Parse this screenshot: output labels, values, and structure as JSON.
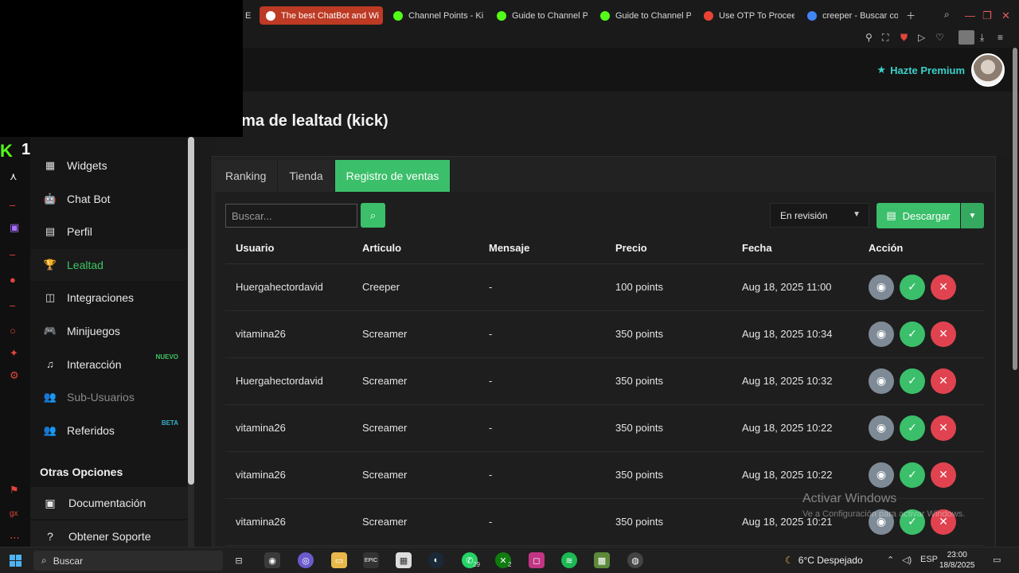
{
  "browser": {
    "tabs": [
      {
        "label": "E",
        "color": "#777777"
      },
      {
        "label": "The best ChatBot and Wi",
        "color": "#ffffff",
        "active": true
      },
      {
        "label": "Channel Points - Ki",
        "color": "#53fc18"
      },
      {
        "label": "Guide to Channel P",
        "color": "#53fc18"
      },
      {
        "label": "Guide to Channel P",
        "color": "#53fc18"
      },
      {
        "label": "Use OTP To Procee",
        "color": "#ea4335"
      },
      {
        "label": "creeper - Buscar co",
        "color": "#4285f4"
      }
    ]
  },
  "header": {
    "premium_label": "Hazte Premium",
    "page_title": "ema de lealtad (kick)"
  },
  "brand": {
    "logo": "K",
    "count": "1"
  },
  "sidebar": {
    "items": [
      {
        "label": "Widgets",
        "icon": "widgets-icon",
        "glyph": "▦"
      },
      {
        "label": "Chat Bot",
        "icon": "robot-icon",
        "glyph": "🤖"
      },
      {
        "label": "Perfil",
        "icon": "profile-card-icon",
        "glyph": "▤"
      },
      {
        "label": "Lealtad",
        "icon": "trophy-icon",
        "glyph": "🏆",
        "active": true
      },
      {
        "label": "Integraciones",
        "icon": "integrations-icon",
        "glyph": "◫"
      },
      {
        "label": "Minijuegos",
        "icon": "gamepad-icon",
        "glyph": "🎮"
      },
      {
        "label": "Interacción",
        "icon": "music-icon",
        "glyph": "♫",
        "badge": "NUEVO"
      },
      {
        "label": "Sub-Usuarios",
        "icon": "users-icon",
        "glyph": "👥",
        "dim": true
      },
      {
        "label": "Referidos",
        "icon": "users-icon",
        "glyph": "👥",
        "badge": "BETA"
      }
    ],
    "section_title": "Otras Opciones",
    "sub_items": [
      {
        "label": "Documentación",
        "icon": "book-icon",
        "glyph": "▣"
      },
      {
        "label": "Obtener Soporte",
        "icon": "question-icon",
        "glyph": "?"
      }
    ]
  },
  "tabs": [
    "Ranking",
    "Tienda",
    "Registro de ventas"
  ],
  "toolbar": {
    "search_placeholder": "Buscar...",
    "status_filter": "En revisión",
    "download_label": "Descargar"
  },
  "table": {
    "columns": [
      "Usuario",
      "Articulo",
      "Mensaje",
      "Precio",
      "Fecha",
      "Acción"
    ],
    "rows": [
      [
        "Huergahectordavid",
        "Creeper",
        "-",
        "100 points",
        "Aug 18, 2025 11:00"
      ],
      [
        "vitamina26",
        "Screamer",
        "-",
        "350 points",
        "Aug 18, 2025 10:34"
      ],
      [
        "Huergahectordavid",
        "Screamer",
        "-",
        "350 points",
        "Aug 18, 2025 10:32"
      ],
      [
        "vitamina26",
        "Screamer",
        "-",
        "350 points",
        "Aug 18, 2025 10:22"
      ],
      [
        "vitamina26",
        "Screamer",
        "-",
        "350 points",
        "Aug 18, 2025 10:22"
      ],
      [
        "vitamina26",
        "Screamer",
        "-",
        "350 points",
        "Aug 18, 2025 10:21"
      ]
    ]
  },
  "watermark": {
    "title": "Activar Windows",
    "subtitle": "Ve a Configuración para activar Windows."
  },
  "taskbar": {
    "search_label": "Buscar",
    "weather": "6°C Despejado",
    "lang": "ESP",
    "time": "23:00",
    "date": "18/8/2025",
    "badges": [
      "29",
      "2"
    ]
  },
  "colors": {
    "accent": "#3bbf6a",
    "premium": "#3ad0c8",
    "danger": "#e0434f",
    "view": "#7e8b96"
  }
}
